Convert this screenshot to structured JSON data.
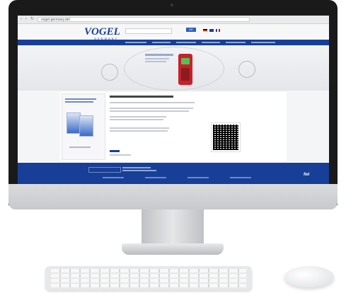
{
  "browser": {
    "url": "vogel-germany.de/"
  },
  "header": {
    "logo": "VOGEL",
    "logo_sub": "GERMANY",
    "language_button": "DE"
  },
  "footer": {
    "brand": "fwi"
  },
  "colors": {
    "brand_blue": "#173f97",
    "accent_red": "#c4232b"
  }
}
